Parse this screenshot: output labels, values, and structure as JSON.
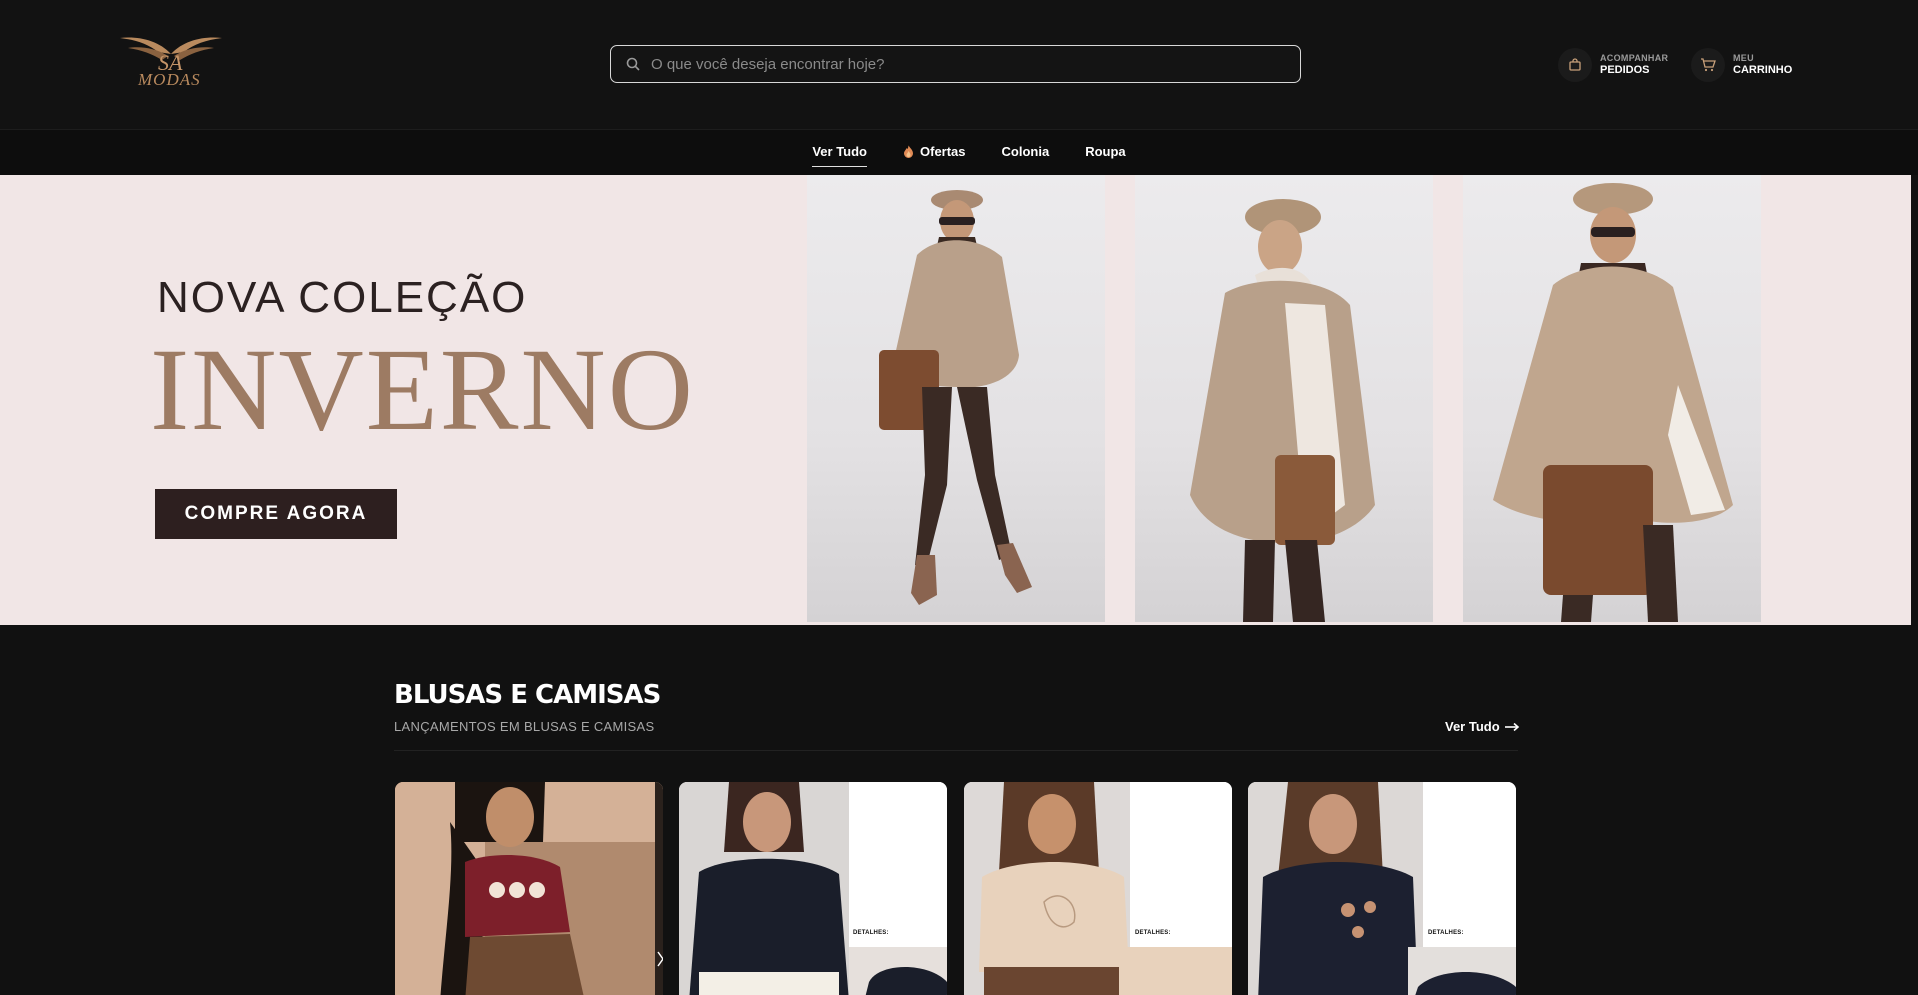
{
  "header": {
    "logo_text": "MODAS",
    "logo_monogram": "SA",
    "search_placeholder": "O que você deseja encontrar hoje?",
    "orders": {
      "small": "ACOMPANHAR",
      "big": "PEDIDOS",
      "icon": "bag-icon"
    },
    "cart": {
      "small": "MEU",
      "big": "CARRINHO",
      "icon": "cart-icon"
    }
  },
  "nav": {
    "items": [
      {
        "label": "Ver Tudo",
        "active": true
      },
      {
        "label": "Ofertas",
        "icon": "flame-icon"
      },
      {
        "label": "Colonia"
      },
      {
        "label": "Roupa"
      }
    ]
  },
  "banner": {
    "subtitle": "NOVA COLEÇÃO",
    "title": "INVERNO",
    "cta": "COMPRE AGORA"
  },
  "section": {
    "title": "BLUSAS E CAMISAS",
    "subtitle": "LANÇAMENTOS EM BLUSAS E CAMISAS",
    "link": "Ver Tudo",
    "cards": [
      {
        "detail": ""
      },
      {
        "detail": "DETALHES:"
      },
      {
        "detail": "DETALHES:"
      },
      {
        "detail": "DETALHES:"
      }
    ]
  },
  "colors": {
    "background": "#111111",
    "banner_bg": "#f1e6e6",
    "accent_brown": "#9d7b63",
    "cta_bg": "#2d1f1f",
    "logo_gold": "#b98a5e"
  }
}
